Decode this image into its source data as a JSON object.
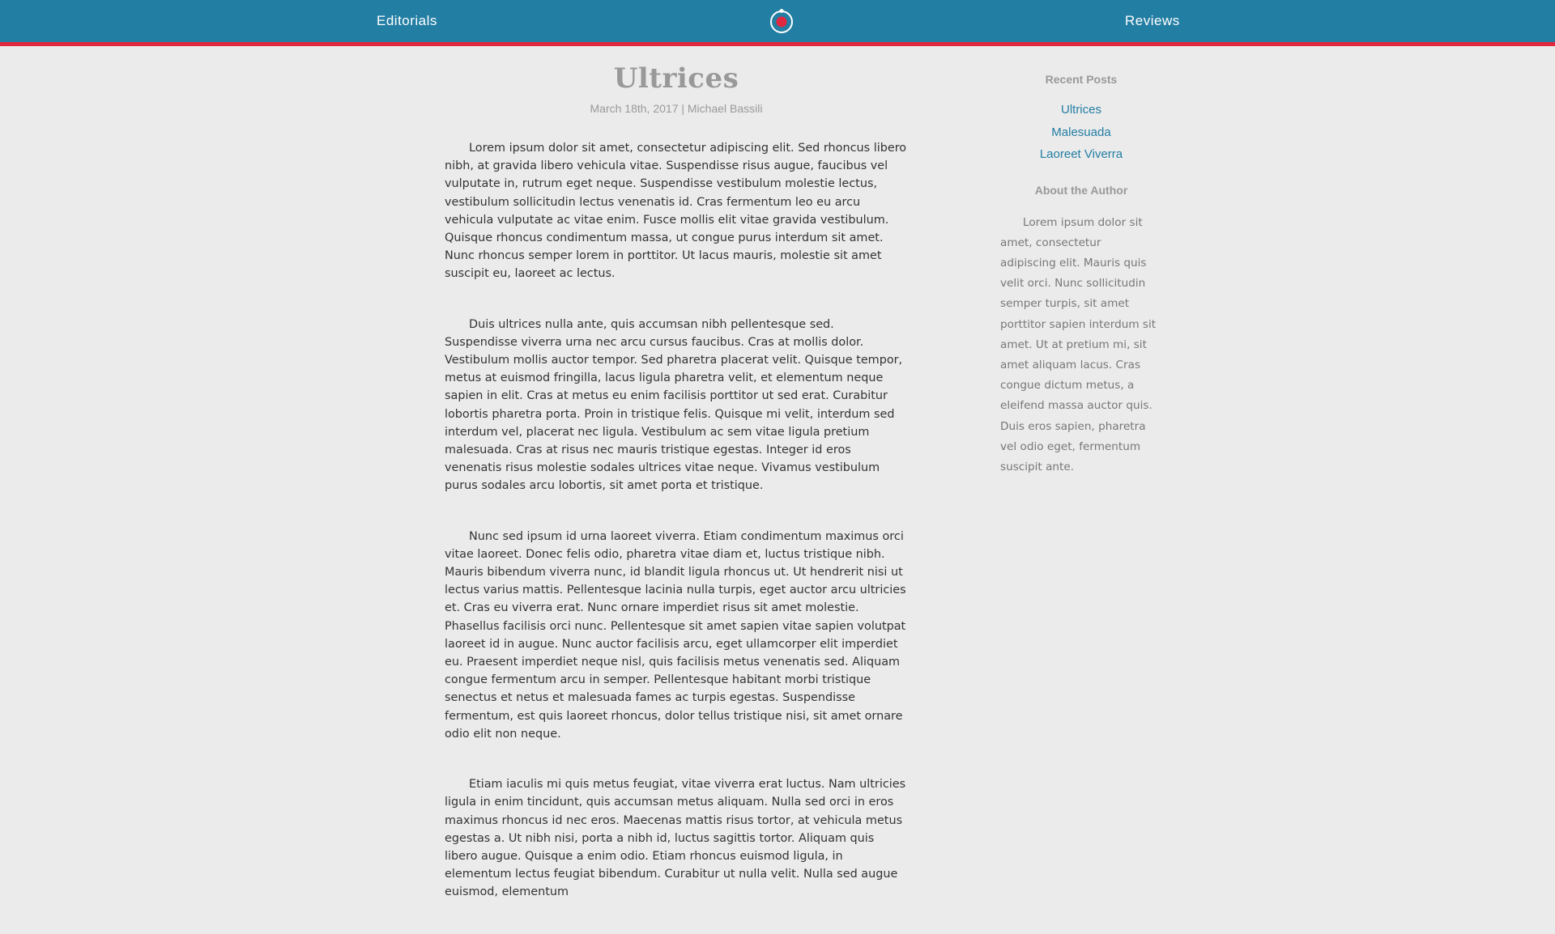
{
  "nav": {
    "left_label": "Editorials",
    "right_label": "Reviews",
    "logo_icon": "record-logo-icon"
  },
  "colors": {
    "header_bg": "#237ea3",
    "header_accent": "#e0283f",
    "page_bg": "#ebebeb",
    "link": "#237ea3"
  },
  "article": {
    "title": "Ultrices",
    "meta": "March 18th, 2017 | Michael Bassili",
    "paragraphs": [
      "Lorem ipsum dolor sit amet, consectetur adipiscing elit. Sed rhoncus libero nibh, at gravida libero vehicula vitae. Suspendisse risus augue, faucibus vel vulputate in, rutrum eget neque. Suspendisse vestibulum molestie lectus, vestibulum sollicitudin lectus venenatis id. Cras fermentum leo eu arcu vehicula vulputate ac vitae enim. Fusce mollis elit vitae gravida vestibulum. Quisque rhoncus condimentum massa, ut congue purus interdum sit amet. Nunc rhoncus semper lorem in porttitor. Ut lacus mauris, molestie sit amet suscipit eu, laoreet ac lectus.",
      "Duis ultrices nulla ante, quis accumsan nibh pellentesque sed. Suspendisse viverra urna nec arcu cursus faucibus. Cras at mollis dolor. Vestibulum mollis auctor tempor. Sed pharetra placerat velit. Quisque tempor, metus at euismod fringilla, lacus ligula pharetra velit, et elementum neque sapien in elit. Cras at metus eu enim facilisis porttitor ut sed erat. Curabitur lobortis pharetra porta. Proin in tristique felis. Quisque mi velit, interdum sed interdum vel, placerat nec ligula. Vestibulum ac sem vitae ligula pretium malesuada. Cras at risus nec mauris tristique egestas. Integer id eros venenatis risus molestie sodales ultrices vitae neque. Vivamus vestibulum purus sodales arcu lobortis, sit amet porta et tristique.",
      "Nunc sed ipsum id urna laoreet viverra. Etiam condimentum maximus orci vitae laoreet. Donec felis odio, pharetra vitae diam et, luctus tristique nibh. Mauris bibendum viverra nunc, id blandit ligula rhoncus ut. Ut hendrerit nisi ut lectus varius mattis. Pellentesque lacinia nulla turpis, eget auctor arcu ultricies et. Cras eu viverra erat. Nunc ornare imperdiet risus sit amet molestie. Phasellus facilisis orci nunc. Pellentesque sit amet sapien vitae sapien volutpat laoreet id in augue. Nunc auctor facilisis arcu, eget ullamcorper elit imperdiet eu. Praesent imperdiet neque nisl, quis facilisis metus venenatis sed. Aliquam congue fermentum arcu in semper. Pellentesque habitant morbi tristique senectus et netus et malesuada fames ac turpis egestas. Suspendisse fermentum, est quis laoreet rhoncus, dolor tellus tristique nisi, sit amet ornare odio elit non neque.",
      "Etiam iaculis mi quis metus feugiat, vitae viverra erat luctus. Nam ultricies ligula in enim tincidunt, quis accumsan metus aliquam. Nulla sed orci in eros maximus rhoncus id nec eros. Maecenas mattis risus tortor, at vehicula metus egestas a. Ut nibh nisi, porta a nibh id, luctus sagittis tortor. Aliquam quis libero augue. Quisque a enim odio. Etiam rhoncus euismod ligula, in elementum lectus feugiat bibendum. Curabitur ut nulla velit. Nulla sed augue euismod, elementum"
    ]
  },
  "sidebar": {
    "recent_heading": "Recent Posts",
    "recent_posts": [
      "Ultrices",
      "Malesuada",
      "Laoreet Viverra"
    ],
    "about_heading": "About the Author",
    "about_text": "Lorem ipsum dolor sit amet, consectetur adipiscing elit. Mauris quis velit orci. Nunc sollicitudin semper turpis, sit amet porttitor sapien interdum sit amet. Ut at pretium mi, sit amet aliquam lacus. Cras congue dictum metus, a eleifend massa auctor quis. Duis eros sapien, pharetra vel odio eget, fermentum suscipit ante."
  }
}
